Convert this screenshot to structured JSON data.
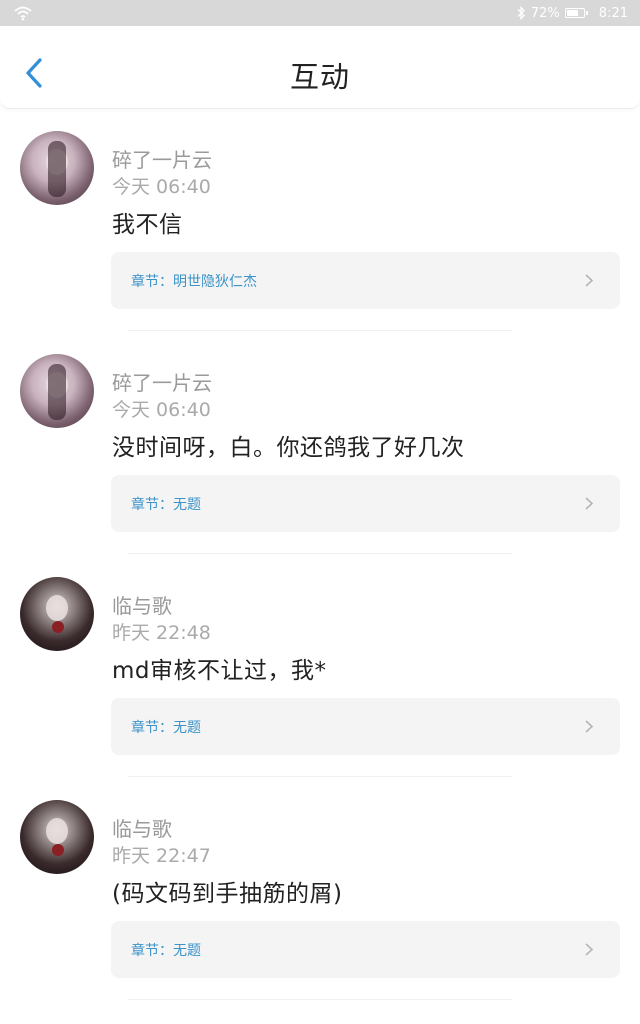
{
  "status_bar": {
    "battery": "72%",
    "battery_level": 0.72,
    "time": "8:21"
  },
  "header": {
    "title": "互动"
  },
  "comments": [
    {
      "user": "碎了一片云",
      "time": "今天 06:40",
      "text": "我不信",
      "chapter": "章节：明世隐狄仁杰"
    },
    {
      "user": "碎了一片云",
      "time": "今天 06:40",
      "text": "没时间呀，白。你还鸽我了好几次",
      "chapter": "章节：无题"
    },
    {
      "user": "临与歌",
      "time": "昨天 22:48",
      "text": "md审核不让过，我*",
      "chapter": "章节：无题"
    },
    {
      "user": "临与歌",
      "time": "昨天 22:47",
      "text": "(码文码到手抽筋的屑)",
      "chapter": "章节：无题"
    }
  ],
  "colors": {
    "accent": "#3b93c9",
    "back_arrow": "#2f8fd8",
    "status_bar": "#d8d8d8"
  },
  "icons": {
    "wifi": "wifi-icon",
    "bluetooth": "bluetooth-icon",
    "battery": "battery-icon",
    "back": "chevron-left-icon",
    "chapter_arrow": "chevron-right-icon"
  }
}
